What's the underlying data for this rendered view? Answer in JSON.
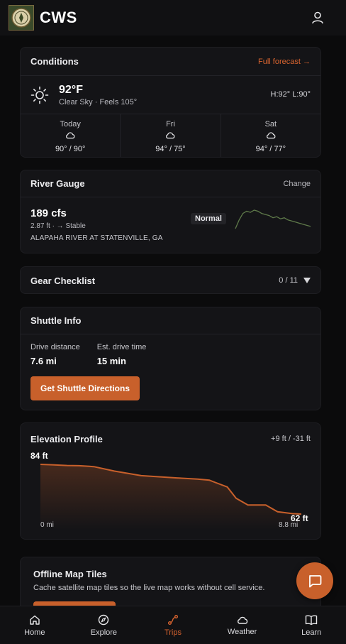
{
  "app": {
    "title": "CWS"
  },
  "conditions": {
    "title": "Conditions",
    "link": "Full forecast →",
    "temp": "92°F",
    "desc": "Clear Sky · Feels 105°",
    "hilo": "H:92° L:90°",
    "forecast": [
      {
        "day": "Today",
        "temps": "90° / 90°"
      },
      {
        "day": "Fri",
        "temps": "94° / 75°"
      },
      {
        "day": "Sat",
        "temps": "94° / 77°"
      }
    ]
  },
  "gauge": {
    "title": "River Gauge",
    "link": "Change",
    "flow": "189 cfs",
    "sub": "2.87 ft · → Stable",
    "station": "ALAPAHA RIVER AT STATENVILLE, GA",
    "status": "Normal"
  },
  "gear": {
    "title": "Gear Checklist",
    "count": "0 / 11"
  },
  "shuttle": {
    "title": "Shuttle Info",
    "distance_label": "Drive distance",
    "distance": "7.6 mi",
    "time_label": "Est. drive time",
    "time": "15 min",
    "button": "Get Shuttle Directions"
  },
  "elevation": {
    "title": "Elevation Profile",
    "range": "+9 ft / -31 ft",
    "max_label": "84 ft",
    "min_label": "62 ft",
    "x_start": "0 mi",
    "x_end": "8.8 mi"
  },
  "offline": {
    "title": "Offline Map Tiles",
    "desc": "Cache satellite map tiles so the live map works without cell service."
  },
  "nav": [
    {
      "label": "Home"
    },
    {
      "label": "Explore"
    },
    {
      "label": "Trips"
    },
    {
      "label": "Weather"
    },
    {
      "label": "Learn"
    }
  ],
  "colors": {
    "accent": "#c8602b",
    "bg": "#0b0b0c",
    "card": "#141417",
    "gauge_line": "#5f7a4a"
  },
  "chart_data": [
    {
      "type": "line",
      "x": [
        0,
        0.4,
        0.9,
        1.3,
        1.8,
        2.5,
        3.4,
        4.6,
        5.3,
        5.7,
        5.9,
        6.3,
        6.6,
        7.0,
        7.6,
        8.0,
        8.5,
        8.8
      ],
      "values": [
        84,
        83.8,
        83.5,
        83.4,
        83,
        81,
        79,
        78,
        77.5,
        77,
        76,
        74,
        69,
        66,
        66,
        63,
        62.2,
        62
      ],
      "xlabel": "",
      "ylabel": "",
      "ylim": [
        62,
        84
      ],
      "xlim": [
        0,
        8.8
      ],
      "grid": false
    },
    {
      "type": "line",
      "x": [
        0,
        1,
        2,
        3,
        4,
        5,
        6,
        7,
        8,
        9,
        10,
        11,
        12,
        13,
        14,
        15,
        16,
        17,
        18,
        19,
        20
      ],
      "values": [
        180,
        188,
        194,
        196,
        195,
        197,
        196,
        194,
        193,
        192,
        190,
        191,
        189,
        190,
        188,
        187,
        186,
        185,
        184,
        183,
        182
      ],
      "xlabel": "",
      "ylabel": "",
      "grid": false
    }
  ]
}
